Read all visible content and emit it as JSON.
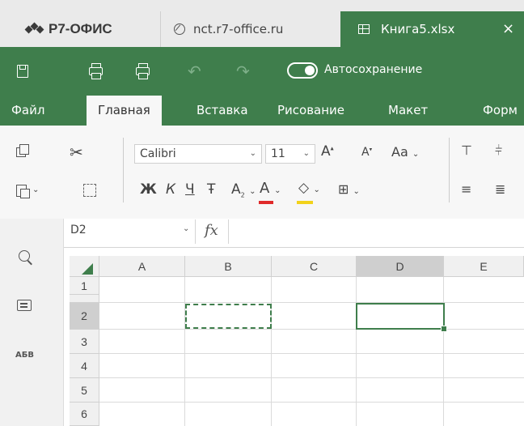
{
  "app": {
    "brand": "Р7-ОФИС"
  },
  "tabs": [
    {
      "label": "nct.r7-office.ru"
    },
    {
      "label": "Книга5.xlsx",
      "close": "×"
    }
  ],
  "quick_access": {
    "autosave_label": "Автосохранение",
    "autosave_on": true
  },
  "ribbon_tabs": [
    "Файл",
    "Главная",
    "Вставка",
    "Рисование",
    "Макет",
    "Форм"
  ],
  "ribbon_active": "Главная",
  "toolbar": {
    "font_name": "Calibri",
    "font_size": "11",
    "grow_font": "A",
    "shrink_font": "A",
    "change_case": "Aa",
    "bold": "Ж",
    "italic": "К",
    "underline": "Ч",
    "strike": "Ŧ",
    "subscript": "A",
    "font_color": "A",
    "font_color_hex": "#e02a2a",
    "fill_color_hex": "#f2d21b",
    "cut": "✂"
  },
  "formula_bar": {
    "cell_ref": "D2",
    "fx": "fx",
    "value": ""
  },
  "columns": [
    "A",
    "B",
    "C",
    "D",
    "E"
  ],
  "rows": [
    "1",
    "2",
    "3",
    "4",
    "5",
    "6"
  ],
  "selection": {
    "active_cell": "D2",
    "copy_marquee": "B2"
  },
  "sidebar": {
    "spell_label": "АБВ"
  },
  "colors": {
    "accent": "#3f7e4c",
    "header_bg": "#f0f0f0",
    "header_selected_bg": "#cfcfcf"
  }
}
